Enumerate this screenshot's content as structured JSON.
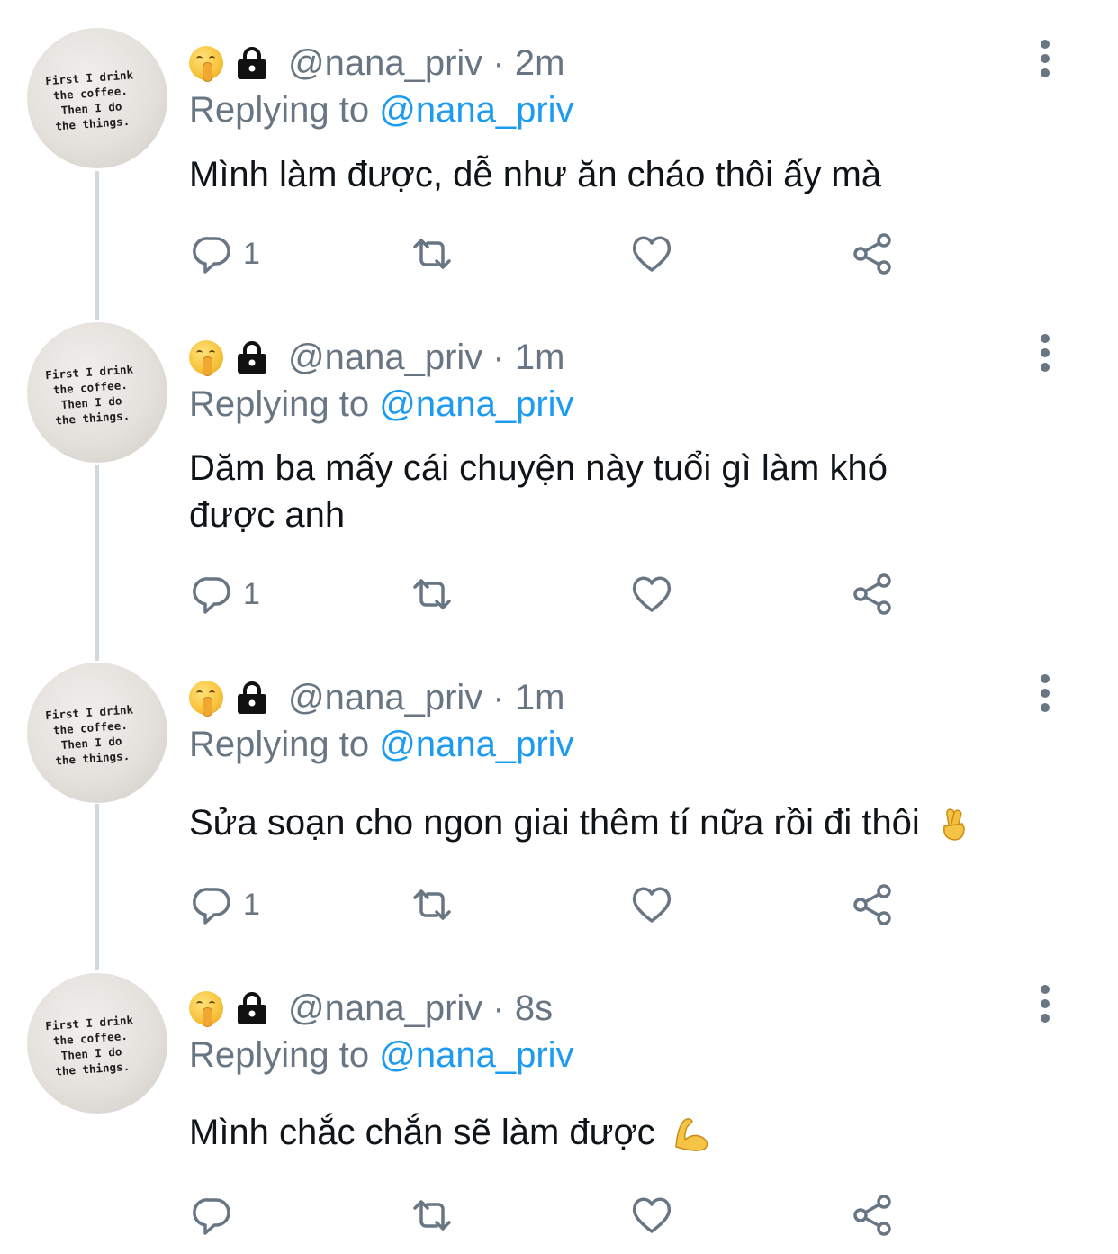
{
  "tweets": [
    {
      "handle": "@nana_priv",
      "time": "2m",
      "reply_prefix": "Replying to ",
      "reply_to": "@nana_priv",
      "text": "Mình làm được, dễ như ăn cháo thôi ấy mà",
      "reply_count": "1"
    },
    {
      "handle": "@nana_priv",
      "time": "1m",
      "reply_prefix": "Replying to ",
      "reply_to": "@nana_priv",
      "text": "Dăm ba mấy cái chuyện này tuổi gì làm khó được anh",
      "reply_count": "1"
    },
    {
      "handle": "@nana_priv",
      "time": "1m",
      "reply_prefix": "Replying to ",
      "reply_to": "@nana_priv",
      "text": "Sửa soạn cho ngon giai thêm tí nữa rồi đi thôi",
      "trailing_emoji": "crossed-fingers",
      "reply_count": "1"
    },
    {
      "handle": "@nana_priv",
      "time": "8s",
      "reply_prefix": "Replying to ",
      "reply_to": "@nana_priv",
      "text": "Mình chắc chắn sẽ làm được",
      "trailing_emoji": "flexed-biceps",
      "reply_count": ""
    }
  ],
  "avatar_text": "First I drink\n the coffee.\n  Then I do\n the things.",
  "icons": [
    "shushing-face-emoji",
    "lock-icon",
    "more-icon",
    "reply-icon",
    "retweet-icon",
    "like-icon",
    "share-icon"
  ],
  "colors": {
    "meta": "#687684",
    "mention": "#1d9bf0",
    "text": "#0f1419",
    "thread_line": "#cfd9de"
  }
}
